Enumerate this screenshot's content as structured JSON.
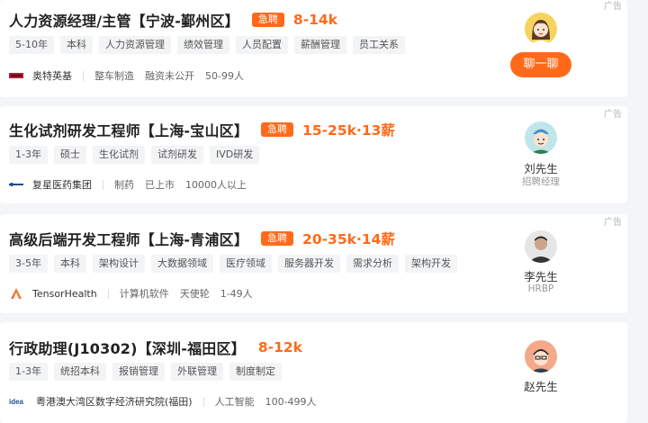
{
  "ad_label": "广告",
  "jobs": [
    {
      "title": "人力资源经理/主管【宁波-鄞州区】",
      "urgent": "急聘",
      "salary": "8-14k",
      "tags": [
        "5-10年",
        "本科",
        "人力资源管理",
        "绩效管理",
        "人员配置",
        "薪酬管理",
        "员工关系"
      ],
      "company": "奥特英基",
      "industry": "整车制造",
      "funding": "融资未公开",
      "size": "50-99人",
      "chat_label": "聊一聊"
    },
    {
      "title": "生化试剂研发工程师【上海-宝山区】",
      "urgent": "急聘",
      "salary": "15-25k·13薪",
      "tags": [
        "1-3年",
        "硕士",
        "生化试剂",
        "试剂研发",
        "IVD研发"
      ],
      "company": "复星医药集团",
      "industry": "制药",
      "funding": "已上市",
      "size": "10000人以上",
      "recruiter": "刘先生",
      "recruiter_role": "招聘经理"
    },
    {
      "title": "高级后端开发工程师【上海-青浦区】",
      "urgent": "急聘",
      "salary": "20-35k·14薪",
      "tags": [
        "3-5年",
        "本科",
        "架构设计",
        "大数据领域",
        "医疗领域",
        "服务器开发",
        "需求分析",
        "架构开发"
      ],
      "company": "TensorHealth",
      "industry": "计算机软件",
      "funding": "天使轮",
      "size": "1-49人",
      "recruiter": "李先生",
      "recruiter_role": "HRBP"
    },
    {
      "title": "行政助理(J10302)【深圳-福田区】",
      "salary": "8-12k",
      "tags": [
        "1-3年",
        "统招本科",
        "报销管理",
        "外联管理",
        "制度制定"
      ],
      "company": "粤港澳大湾区数字经济研究院(福田)",
      "industry": "人工智能",
      "size": "100-499人",
      "recruiter": "赵先生"
    }
  ],
  "colors": {
    "accent": "#ff6a1a",
    "tag_bg": "#f3f4f6"
  }
}
